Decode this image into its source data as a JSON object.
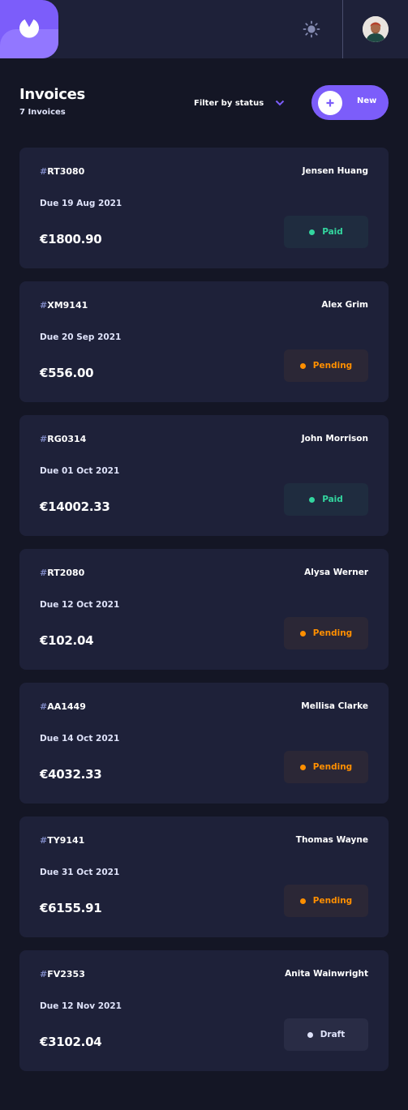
{
  "header": {
    "logo_icon": "logo-icon",
    "theme_icon": "sun-icon",
    "avatar": "user-avatar"
  },
  "page": {
    "title": "Invoices",
    "subtitle": "7 Invoices",
    "filter_label": "Filter by status",
    "new_button_label": "New"
  },
  "colors": {
    "accent": "#7c5dfa",
    "paid": "#33d69f",
    "pending": "#ff8f00",
    "draft": "#dfe3fa",
    "background": "#141625",
    "card": "#1e2139"
  },
  "invoices": [
    {
      "hash": "#",
      "id": "RT3080",
      "client": "Jensen Huang",
      "due": "Due 19 Aug 2021",
      "amount": "€1800.90",
      "status": "Paid"
    },
    {
      "hash": "#",
      "id": "XM9141",
      "client": "Alex Grim",
      "due": "Due 20 Sep 2021",
      "amount": "€556.00",
      "status": "Pending"
    },
    {
      "hash": "#",
      "id": "RG0314",
      "client": "John Morrison",
      "due": "Due 01 Oct 2021",
      "amount": "€14002.33",
      "status": "Paid"
    },
    {
      "hash": "#",
      "id": "RT2080",
      "client": "Alysa Werner",
      "due": "Due 12 Oct 2021",
      "amount": "€102.04",
      "status": "Pending"
    },
    {
      "hash": "#",
      "id": "AA1449",
      "client": "Mellisa Clarke",
      "due": "Due 14 Oct 2021",
      "amount": "€4032.33",
      "status": "Pending"
    },
    {
      "hash": "#",
      "id": "TY9141",
      "client": "Thomas Wayne",
      "due": "Due 31 Oct 2021",
      "amount": "€6155.91",
      "status": "Pending"
    },
    {
      "hash": "#",
      "id": "FV2353",
      "client": "Anita Wainwright",
      "due": "Due 12 Nov 2021",
      "amount": "€3102.04",
      "status": "Draft"
    }
  ]
}
